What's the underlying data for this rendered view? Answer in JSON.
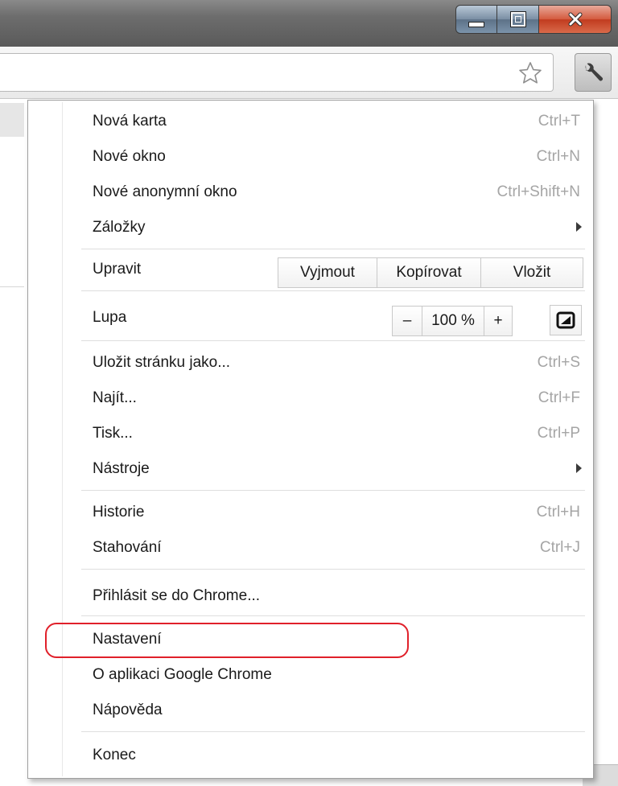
{
  "menu": {
    "new_tab": {
      "label": "Nová karta",
      "shortcut": "Ctrl+T"
    },
    "new_window": {
      "label": "Nové okno",
      "shortcut": "Ctrl+N"
    },
    "incognito": {
      "label": "Nové anonymní okno",
      "shortcut": "Ctrl+Shift+N"
    },
    "bookmarks": {
      "label": "Záložky"
    },
    "edit": {
      "label": "Upravit",
      "cut": "Vyjmout",
      "copy": "Kopírovat",
      "paste": "Vložit"
    },
    "zoom": {
      "label": "Lupa",
      "minus": "–",
      "value": "100 %",
      "plus": "+"
    },
    "save_page": {
      "label": "Uložit stránku jako...",
      "shortcut": "Ctrl+S"
    },
    "find": {
      "label": "Najít...",
      "shortcut": "Ctrl+F"
    },
    "print": {
      "label": "Tisk...",
      "shortcut": "Ctrl+P"
    },
    "tools": {
      "label": "Nástroje"
    },
    "history": {
      "label": "Historie",
      "shortcut": "Ctrl+H"
    },
    "downloads": {
      "label": "Stahování",
      "shortcut": "Ctrl+J"
    },
    "sign_in": {
      "label": "Přihlásit se do Chrome..."
    },
    "settings": {
      "label": "Nastavení"
    },
    "about": {
      "label": "O aplikaci Google Chrome"
    },
    "help": {
      "label": "Nápověda"
    },
    "exit": {
      "label": "Konec"
    }
  },
  "icons": {
    "star": "star-icon",
    "wrench": "wrench-icon",
    "fullscreen": "fullscreen-icon",
    "submenu_arrow": "chevron-right-icon"
  },
  "colors": {
    "highlight_ring": "#e0202a",
    "shortcut_text": "#a5a5a5",
    "close_button": "#c13b1f"
  }
}
